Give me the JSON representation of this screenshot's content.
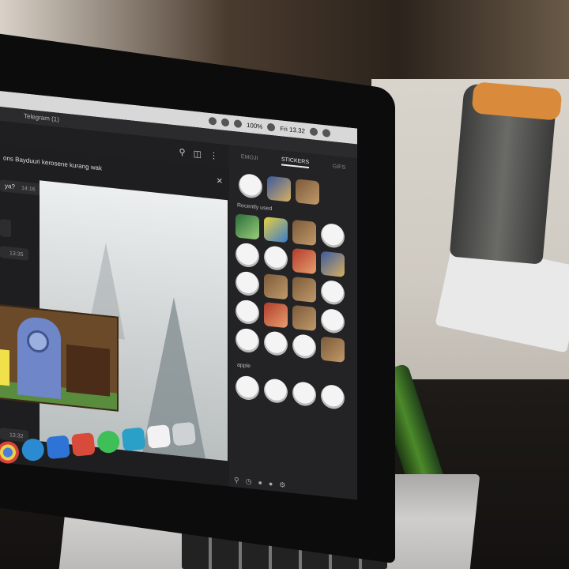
{
  "menubar": {
    "battery": "100%",
    "clock": "Fri 13.32"
  },
  "window": {
    "title": "Telegram (1)"
  },
  "chat": {
    "reply_text": "ons Bayduuri kerosene kurang wak",
    "messages": [
      {
        "text": "ya?",
        "time": "14:16"
      },
      {
        "text": "",
        "time": "13:35"
      },
      {
        "text": "",
        "time": "13:32"
      }
    ]
  },
  "sticker_panel": {
    "tabs": [
      "EMOJI",
      "STICKERS",
      "GIFS"
    ],
    "active_tab": "STICKERS",
    "sections": {
      "recent": "Recently used",
      "apple": "apple"
    }
  },
  "icons": {
    "search": "search-icon",
    "columns": "columns-icon",
    "more": "more-icon",
    "close": "close-icon",
    "emoji": "emoji-icon",
    "mic": "mic-icon",
    "settings": "settings-icon"
  },
  "dock": {
    "apps": [
      "chrome",
      "telegram",
      "app-store",
      "folder",
      "whatsapp",
      "files",
      "document",
      "trash"
    ]
  }
}
